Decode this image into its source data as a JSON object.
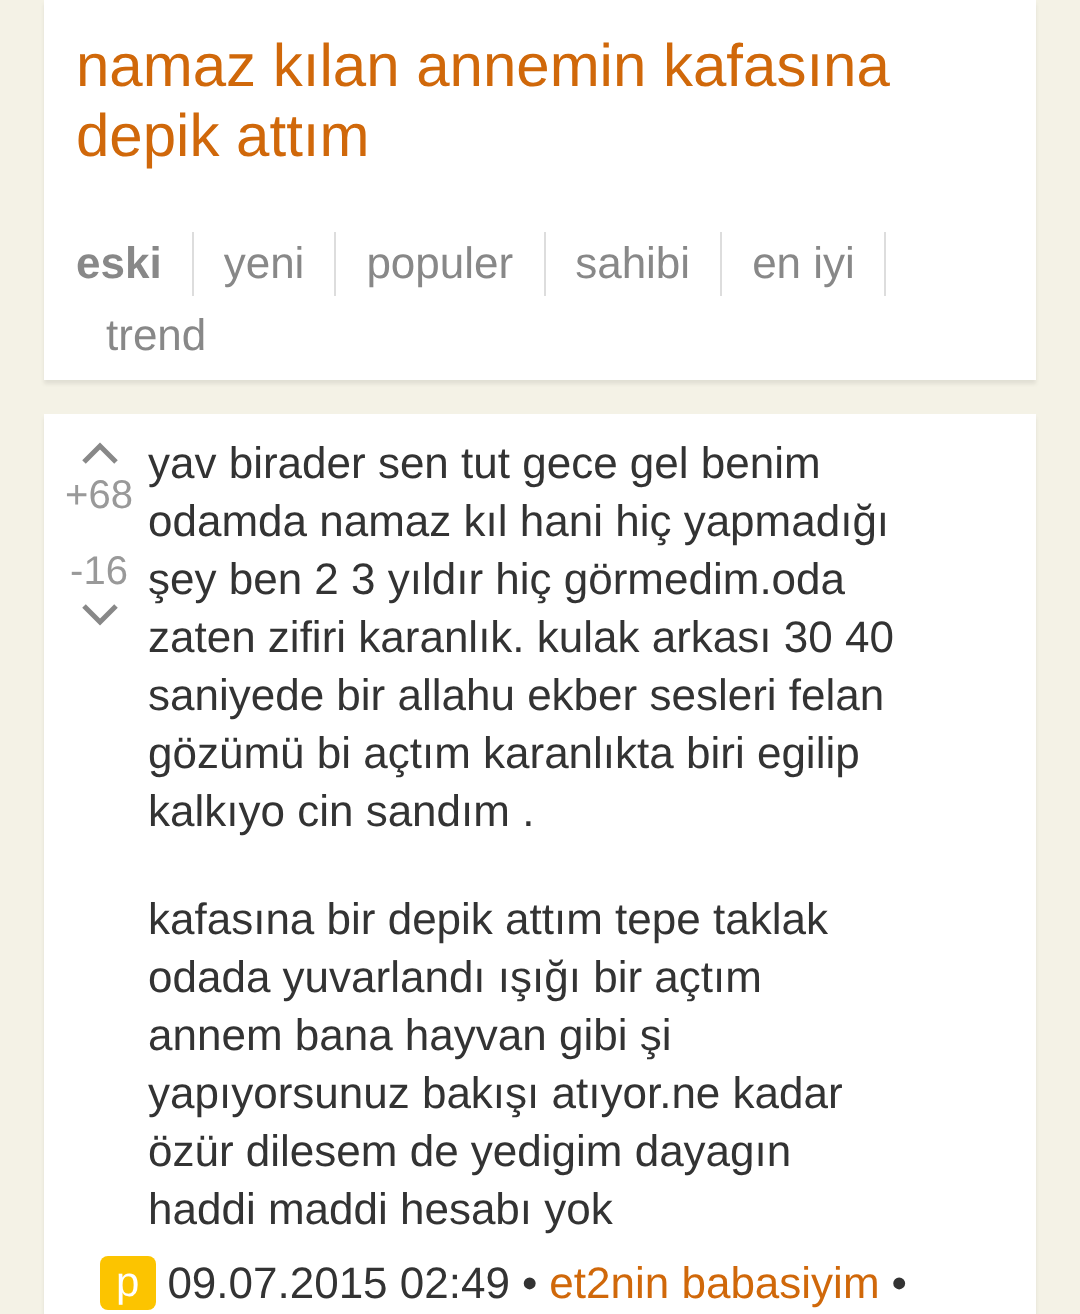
{
  "topic": {
    "title": "namaz kılan annemin kafasına depik attım"
  },
  "tabs": [
    {
      "label": "eski",
      "selected": true
    },
    {
      "label": "yeni",
      "selected": false
    },
    {
      "label": "populer",
      "selected": false
    },
    {
      "label": "sahibi",
      "selected": false
    },
    {
      "label": "en iyi",
      "selected": false
    },
    {
      "label": "trend",
      "selected": false
    }
  ],
  "entry": {
    "upvotes": "+68",
    "downvotes": "-16",
    "paragraphs": [
      "yav birader sen tut gece gel benim\nodamda namaz kıl hani hiç yapmadığı\nşey ben 2 3 yıldır hiç görmedim.oda\nzaten zifiri karanlık. kulak arkası 30 40\nsaniyede bir allahu ekber sesleri felan\ngözümü bi açtım karanlıkta biri egilip\nkalkıyo cin sandım .",
      "kafasına bir depik attım tepe taklak\nodada yuvarlandı ışığı bir açtım\nannem bana hayvan gibi şi\nyapıyorsunuz bakışı atıyor.ne kadar\nözür dilesem de yedigim dayagın\nhaddi maddi hesabı yok"
    ],
    "badge": "p",
    "date": "09.07.2015 02:49",
    "separator_1": "•",
    "author": "et2nin babasiyim",
    "separator_2": "•"
  }
}
